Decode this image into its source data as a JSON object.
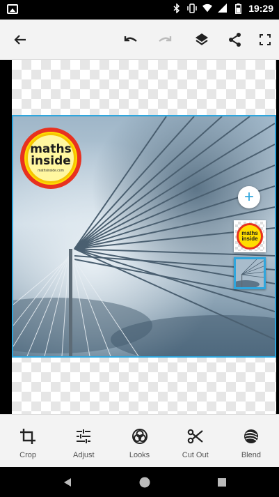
{
  "status_bar": {
    "time": "19:29"
  },
  "toolbar": {
    "back": "back-arrow-icon",
    "undo": "undo-icon",
    "redo": "redo-icon",
    "layers": "layers-icon",
    "share": "share-icon",
    "fullscreen": "fullscreen-icon"
  },
  "canvas": {
    "logo": {
      "line1": "maths",
      "line2": "inside",
      "line3": "mathsinside.com"
    }
  },
  "layers_panel": {
    "add_label": "+",
    "logo_layer": {
      "line1": "maths",
      "line2": "inside"
    }
  },
  "tools": [
    {
      "label": "Crop",
      "icon": "crop-icon"
    },
    {
      "label": "Adjust",
      "icon": "adjust-icon"
    },
    {
      "label": "Looks",
      "icon": "looks-icon"
    },
    {
      "label": "Cut Out",
      "icon": "scissors-icon"
    },
    {
      "label": "Blend",
      "icon": "blend-icon"
    }
  ],
  "colors": {
    "accent": "#2fa6dd",
    "toolbar_bg": "#f3f3f3",
    "logo_yellow": "#ffdd00",
    "logo_red": "#e8311f"
  }
}
